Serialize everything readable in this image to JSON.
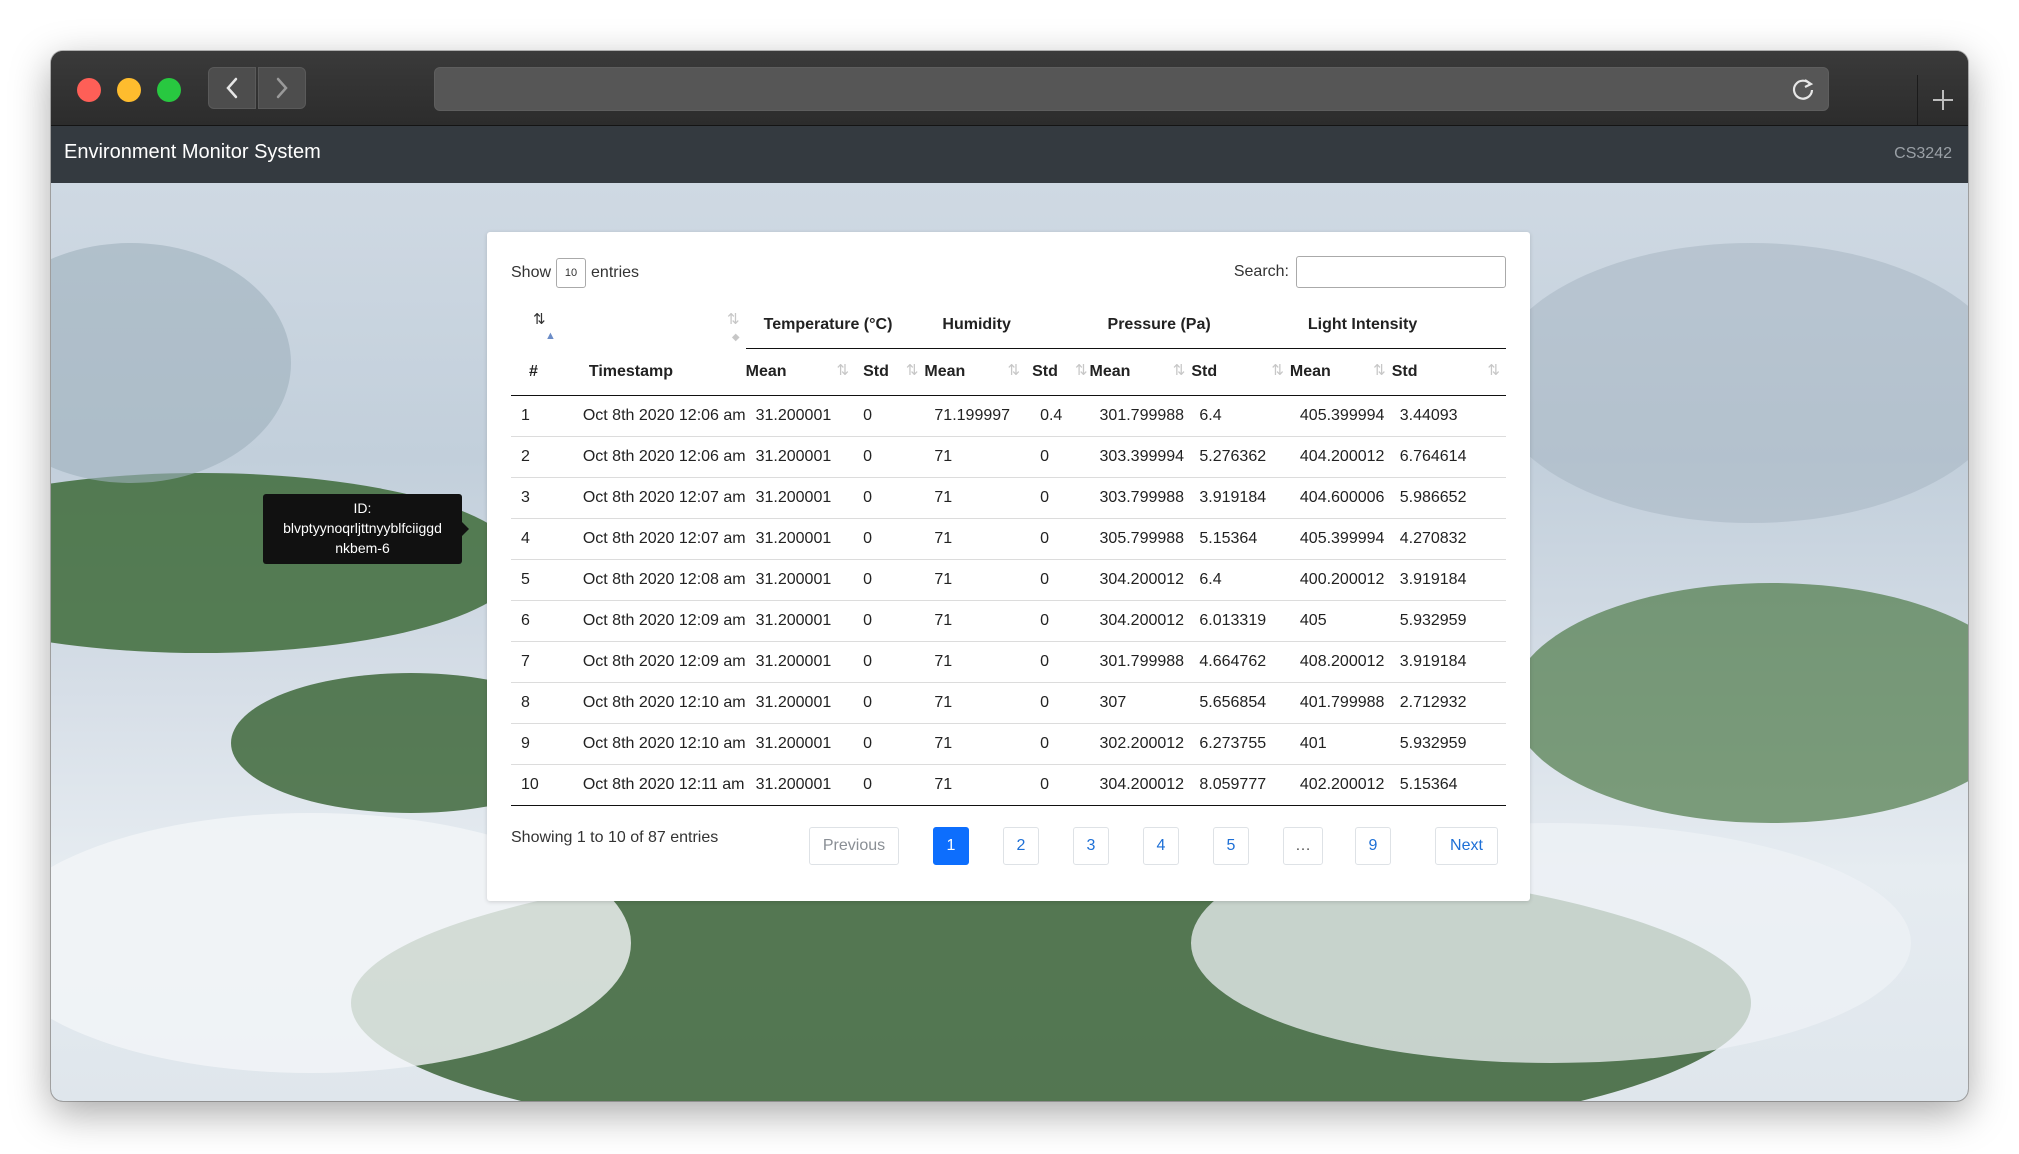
{
  "app": {
    "title": "Environment Monitor System",
    "course_code": "CS3242"
  },
  "length_control": {
    "prefix": "Show",
    "value": "10",
    "suffix": "entries"
  },
  "search": {
    "label": "Search:",
    "value": ""
  },
  "table": {
    "groups": [
      "Temperature (°C)",
      "Humidity",
      "Pressure (Pa)",
      "Light Intensity"
    ],
    "columns": [
      "#",
      "Timestamp",
      "Mean",
      "Std",
      "Mean",
      "Std",
      "Mean",
      "Std",
      "Mean",
      "Std"
    ],
    "rows": [
      [
        "1",
        "Oct 8th 2020 12:06 am",
        "31.200001",
        "0",
        "71.199997",
        "0.4",
        "301.799988",
        "6.4",
        "405.399994",
        "3.44093"
      ],
      [
        "2",
        "Oct 8th 2020 12:06 am",
        "31.200001",
        "0",
        "71",
        "0",
        "303.399994",
        "5.276362",
        "404.200012",
        "6.764614"
      ],
      [
        "3",
        "Oct 8th 2020 12:07 am",
        "31.200001",
        "0",
        "71",
        "0",
        "303.799988",
        "3.919184",
        "404.600006",
        "5.986652"
      ],
      [
        "4",
        "Oct 8th 2020 12:07 am",
        "31.200001",
        "0",
        "71",
        "0",
        "305.799988",
        "5.15364",
        "405.399994",
        "4.270832"
      ],
      [
        "5",
        "Oct 8th 2020 12:08 am",
        "31.200001",
        "0",
        "71",
        "0",
        "304.200012",
        "6.4",
        "400.200012",
        "3.919184"
      ],
      [
        "6",
        "Oct 8th 2020 12:09 am",
        "31.200001",
        "0",
        "71",
        "0",
        "304.200012",
        "6.013319",
        "405",
        "5.932959"
      ],
      [
        "7",
        "Oct 8th 2020 12:09 am",
        "31.200001",
        "0",
        "71",
        "0",
        "301.799988",
        "4.664762",
        "408.200012",
        "3.919184"
      ],
      [
        "8",
        "Oct 8th 2020 12:10 am",
        "31.200001",
        "0",
        "71",
        "0",
        "307",
        "5.656854",
        "401.799988",
        "2.712932"
      ],
      [
        "9",
        "Oct 8th 2020 12:10 am",
        "31.200001",
        "0",
        "71",
        "0",
        "302.200012",
        "6.273755",
        "401",
        "5.932959"
      ],
      [
        "10",
        "Oct 8th 2020 12:11 am",
        "31.200001",
        "0",
        "71",
        "0",
        "304.200012",
        "8.059777",
        "402.200012",
        "5.15364"
      ]
    ]
  },
  "info": "Showing 1 to 10 of 87 entries",
  "pagination": {
    "previous": "Previous",
    "pages": [
      "1",
      "2",
      "3",
      "4",
      "5",
      "…",
      "9"
    ],
    "current": "1",
    "next": "Next"
  },
  "tooltip": {
    "line1": "ID:",
    "line2": "blvptyynoqrljttnyyblfciiggd",
    "line3": "nkbem-6"
  },
  "colors": {
    "navbar": "#343a40",
    "accent": "#0d6efd",
    "link": "#1d6fd6"
  },
  "icons": {
    "back": "chevron-left-icon",
    "forward": "chevron-right-icon",
    "reload": "reload-icon",
    "new_tab": "plus-icon",
    "sort": "sort-icon"
  }
}
